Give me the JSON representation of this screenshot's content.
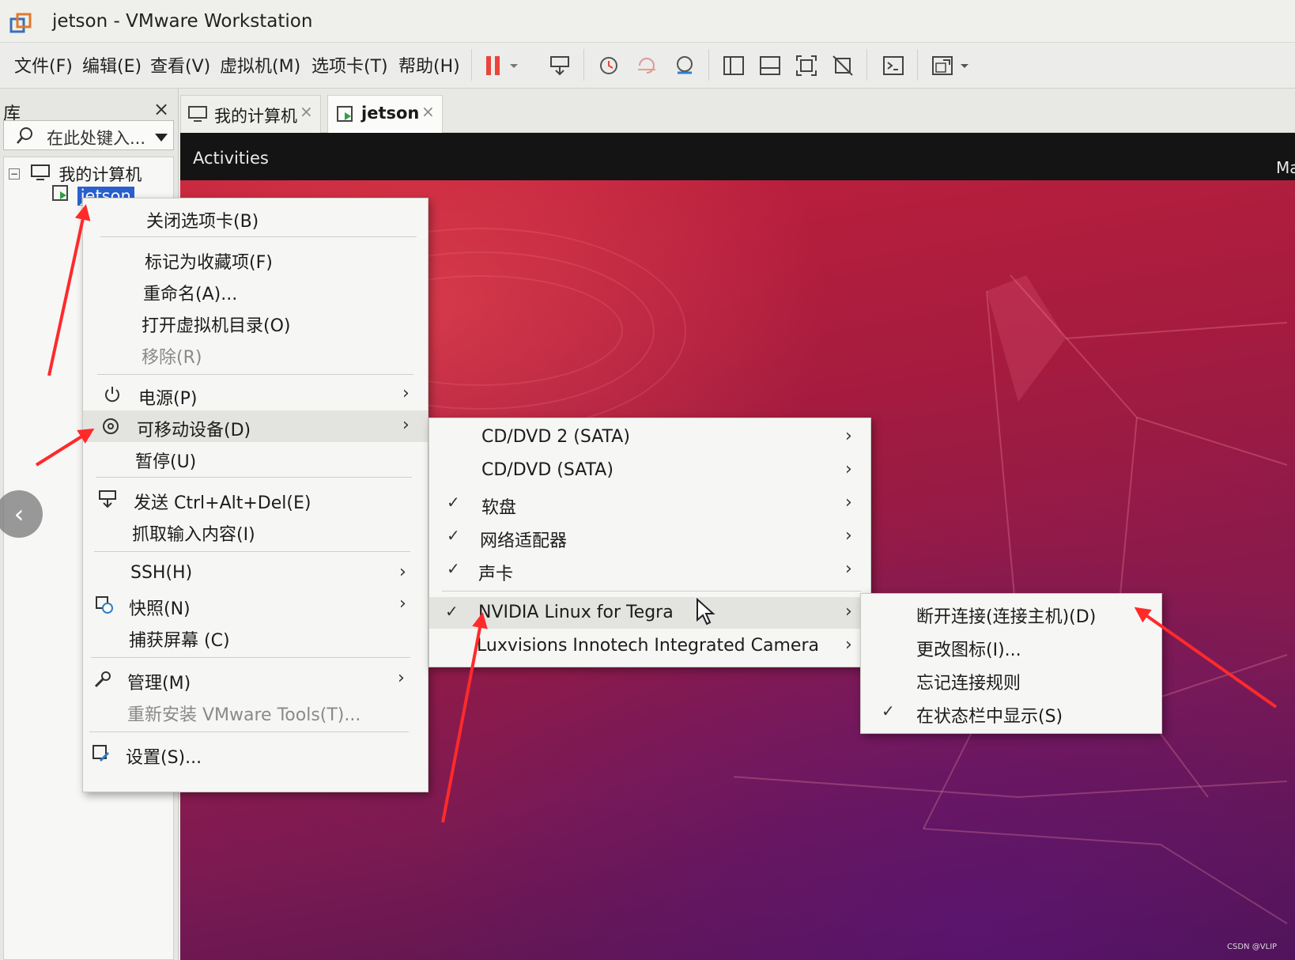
{
  "window": {
    "title": "jetson - VMware Workstation"
  },
  "menubar": {
    "items": [
      "文件(F)",
      "编辑(E)",
      "查看(V)",
      "虚拟机(M)",
      "选项卡(T)",
      "帮助(H)"
    ]
  },
  "library": {
    "title": "库",
    "search_placeholder": "在此处键入...",
    "tree": {
      "root": "我的计算机",
      "child": "jetson"
    }
  },
  "tabs": [
    {
      "label": "我的计算机"
    },
    {
      "label": "jetson"
    }
  ],
  "guest": {
    "activities": "Activities",
    "top_right": "Ma"
  },
  "context_menu": {
    "items": [
      {
        "label": "关闭选项卡(B)"
      },
      {
        "label": "标记为收藏项(F)"
      },
      {
        "label": "重命名(A)..."
      },
      {
        "label": "打开虚拟机目录(O)"
      },
      {
        "label": "移除(R)"
      },
      {
        "label": "电源(P)"
      },
      {
        "label": "可移动设备(D)"
      },
      {
        "label": "暂停(U)"
      },
      {
        "label": "发送 Ctrl+Alt+Del(E)"
      },
      {
        "label": "抓取输入内容(I)"
      },
      {
        "label": "SSH(H)"
      },
      {
        "label": "快照(N)"
      },
      {
        "label": "捕获屏幕 (C)"
      },
      {
        "label": "管理(M)"
      },
      {
        "label": "重新安装 VMware Tools(T)..."
      },
      {
        "label": "设置(S)..."
      }
    ]
  },
  "devices_menu": {
    "items": [
      {
        "label": "CD/DVD 2 (SATA)"
      },
      {
        "label": "CD/DVD (SATA)"
      },
      {
        "label": "软盘"
      },
      {
        "label": "网络适配器"
      },
      {
        "label": "声卡"
      },
      {
        "label": "NVIDIA Linux for Tegra"
      },
      {
        "label": "Luxvisions Innotech Integrated Camera"
      }
    ]
  },
  "device_submenu": {
    "items": [
      {
        "label": "断开连接(连接主机)(D)"
      },
      {
        "label": "更改图标(I)..."
      },
      {
        "label": "忘记连接规则"
      },
      {
        "label": "在状态栏中显示(S)"
      }
    ]
  },
  "watermark": "CSDN @VLIP",
  "colors": {
    "accent": "#2a5fcf",
    "annotation": "#ff2a2a",
    "pause": "#e8453c"
  }
}
